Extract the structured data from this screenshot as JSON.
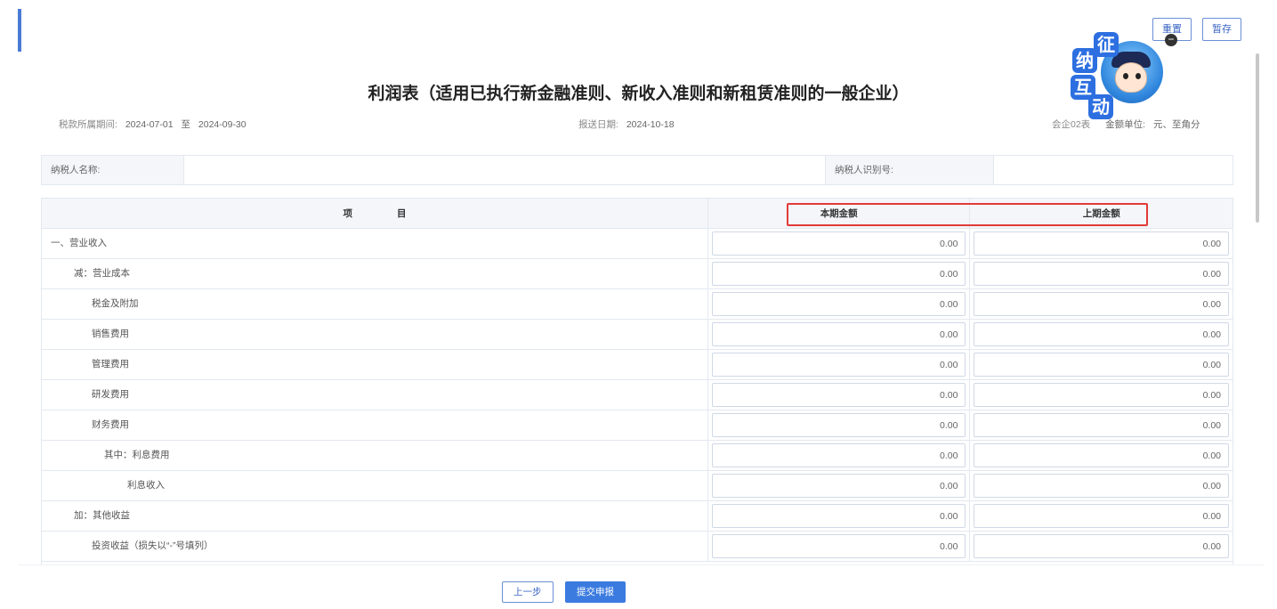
{
  "toolbar": {
    "reset_label": "重置",
    "save_label": "暂存"
  },
  "widget": {
    "chars": [
      "征",
      "纳",
      "互",
      "动"
    ]
  },
  "title": "利润表（适用已执行新金融准则、新收入准则和新租赁准则的一般企业）",
  "meta": {
    "period_label": "税款所属期间:",
    "period_start": "2024-07-01",
    "period_to": "至",
    "period_end": "2024-09-30",
    "report_date_label": "报送日期:",
    "report_date": "2024-10-18",
    "form_code": "会企02表",
    "unit_label": "金额单位:",
    "unit_value": "元、至角分"
  },
  "taxpayer": {
    "name_label": "纳税人名称:",
    "name_value": "",
    "id_label": "纳税人识别号:",
    "id_value": ""
  },
  "table": {
    "headers": {
      "item": "项目",
      "current": "本期金额",
      "previous": "上期金额"
    },
    "rows": [
      {
        "label": "一、营业收入",
        "current": "0.00",
        "previous": "0.00"
      },
      {
        "label": "减：营业成本",
        "current": "0.00",
        "previous": "0.00"
      },
      {
        "label": "税金及附加",
        "current": "0.00",
        "previous": "0.00"
      },
      {
        "label": "销售费用",
        "current": "0.00",
        "previous": "0.00"
      },
      {
        "label": "管理费用",
        "current": "0.00",
        "previous": "0.00"
      },
      {
        "label": "研发费用",
        "current": "0.00",
        "previous": "0.00"
      },
      {
        "label": "财务费用",
        "current": "0.00",
        "previous": "0.00"
      },
      {
        "label": "其中：利息费用",
        "current": "0.00",
        "previous": "0.00"
      },
      {
        "label": "利息收入",
        "current": "0.00",
        "previous": "0.00"
      },
      {
        "label": "加：其他收益",
        "current": "0.00",
        "previous": "0.00"
      },
      {
        "label": "投资收益（损失以“-”号填列）",
        "current": "0.00",
        "previous": "0.00"
      }
    ]
  },
  "footer": {
    "prev_label": "上一步",
    "submit_label": "提交申报"
  },
  "colors": {
    "accent": "#3b7be0",
    "highlight": "#e23a3a"
  }
}
